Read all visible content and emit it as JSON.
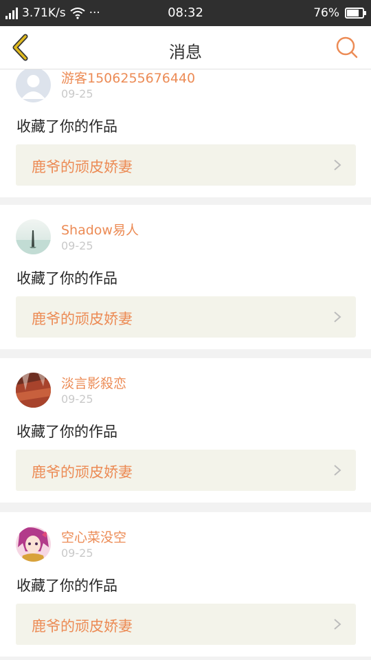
{
  "status_bar": {
    "speed": "3.71K/s",
    "dots": "···",
    "time": "08:32",
    "battery": "76%",
    "battery_level": 0.76
  },
  "header": {
    "title": "消息",
    "back_icon": "chevron-left-icon",
    "search_icon": "search-icon",
    "accent_color": "#e0ba1f",
    "search_color": "#ec8b55"
  },
  "messages": [
    {
      "username": "游客1506255676440",
      "date": "09-25",
      "action": "收藏了你的作品",
      "work_title": "鹿爷的顽皮娇妻",
      "avatar": "default-avatar"
    },
    {
      "username": "Shadow易人",
      "date": "09-25",
      "action": "收藏了你的作品",
      "work_title": "鹿爷的顽皮娇妻",
      "avatar": "landscape-avatar"
    },
    {
      "username": "淡言影殺恋",
      "date": "09-25",
      "action": "收藏了你的作品",
      "work_title": "鹿爷的顽皮娇妻",
      "avatar": "red-photo-avatar"
    },
    {
      "username": "空心菜没空",
      "date": "09-25",
      "action": "收藏了你的作品",
      "work_title": "鹿爷的顽皮娇妻",
      "avatar": "anime-avatar"
    }
  ]
}
